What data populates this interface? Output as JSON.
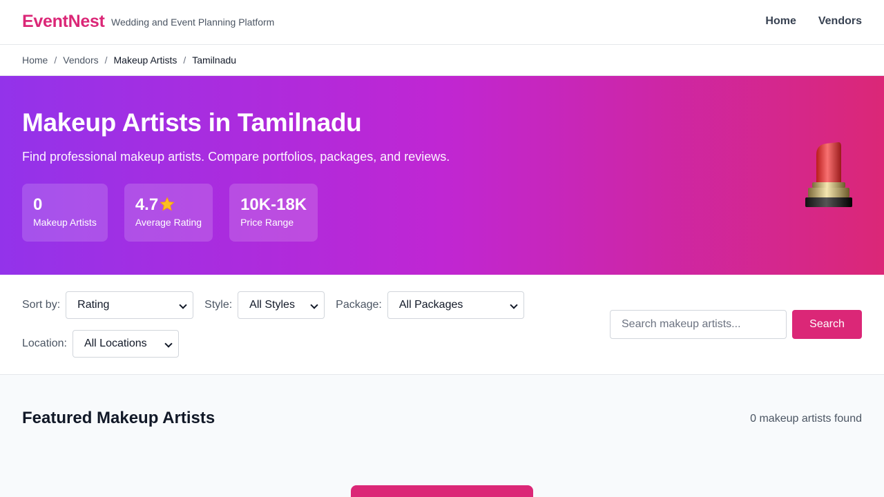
{
  "header": {
    "brand": "EventNest",
    "tagline": "Wedding and Event Planning Platform",
    "nav": [
      "Home",
      "Vendors"
    ]
  },
  "breadcrumb": {
    "items": [
      "Home",
      "Vendors",
      "Makeup Artists"
    ],
    "current": "Tamilnadu",
    "separator": "/"
  },
  "hero": {
    "title": "Makeup Artists in Tamilnadu",
    "subtitle": "Find professional makeup artists. Compare portfolios, packages, and reviews.",
    "illustration_icon": "lipstick-icon",
    "stats": [
      {
        "value": "0",
        "label": "Makeup Artists"
      },
      {
        "value": "4.7",
        "label": "Average Rating",
        "icon": "star-icon"
      },
      {
        "value": "10K-18K",
        "label": "Price Range"
      }
    ]
  },
  "filters": {
    "sort": {
      "label": "Sort by:",
      "value": "Rating"
    },
    "style": {
      "label": "Style:",
      "value": "All Styles"
    },
    "package": {
      "label": "Package:",
      "value": "All Packages"
    },
    "location": {
      "label": "Location:",
      "value": "All Locations"
    },
    "search": {
      "placeholder": "Search makeup artists...",
      "button": "Search"
    }
  },
  "results": {
    "title": "Featured Makeup Artists",
    "count": "0 makeup artists found"
  },
  "colors": {
    "brand": "#db2777",
    "hero_start": "#9333ea",
    "hero_end": "#db2777"
  }
}
